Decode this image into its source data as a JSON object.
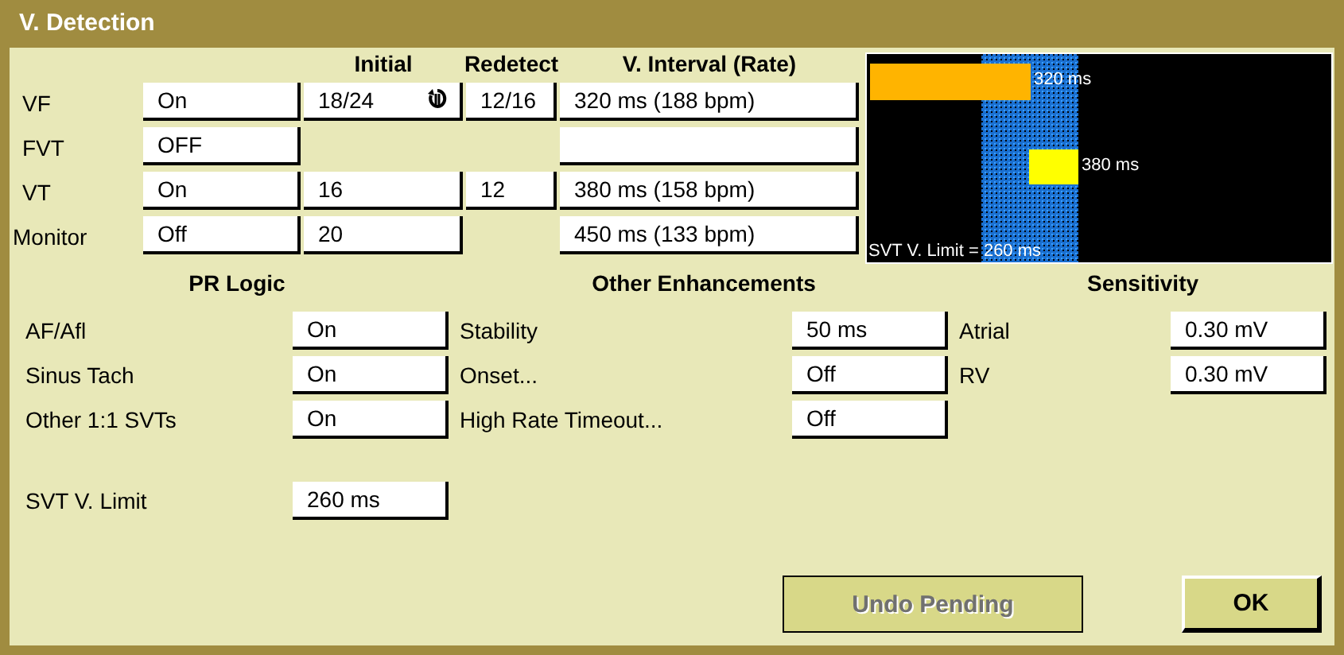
{
  "window": {
    "title": "V. Detection"
  },
  "detection": {
    "columns": [
      "Initial",
      "Redetect",
      "V. Interval (Rate)"
    ],
    "zones": [
      {
        "name": "VF",
        "status": "On",
        "initial": "18/24",
        "initial_icon": true,
        "redetect": "12/16",
        "interval": "320 ms (188 bpm)"
      },
      {
        "name": "FVT",
        "status": "OFF"
      },
      {
        "name": "VT",
        "status": "On",
        "initial": "16",
        "initial_icon": false,
        "redetect": "12",
        "interval": "380 ms (158 bpm)"
      },
      {
        "name": "Monitor",
        "status": "Off",
        "initial": "20",
        "initial_icon": false,
        "interval": "450 ms (133 bpm)"
      }
    ]
  },
  "rate_chart": {
    "bars": [
      {
        "label": "320 ms",
        "color": "#ffb400"
      },
      {
        "label": "380 ms",
        "color": "#ffff00"
      }
    ],
    "limit_label": "SVT V. Limit = 260 ms"
  },
  "sections": [
    {
      "title": "PR Logic",
      "rows": [
        {
          "label": "AF/Afl",
          "value": "On"
        },
        {
          "label": "Sinus Tach",
          "value": "On"
        },
        {
          "label": "Other 1:1 SVTs",
          "value": "On"
        }
      ]
    },
    {
      "title": "Other Enhancements",
      "rows": [
        {
          "label": "Stability",
          "value": "50 ms"
        },
        {
          "label": "Onset...",
          "value": "Off"
        },
        {
          "label": "High Rate Timeout...",
          "value": "Off"
        }
      ]
    },
    {
      "title": "Sensitivity",
      "rows": [
        {
          "label": "Atrial",
          "value": "0.30 mV"
        },
        {
          "label": "RV",
          "value": "0.30 mV"
        }
      ]
    }
  ],
  "svt_limit": {
    "label": "SVT V. Limit",
    "value": "260 ms"
  },
  "buttons": [
    {
      "label": "Undo Pending",
      "disabled": true
    },
    {
      "label": "OK",
      "disabled": false
    }
  ]
}
